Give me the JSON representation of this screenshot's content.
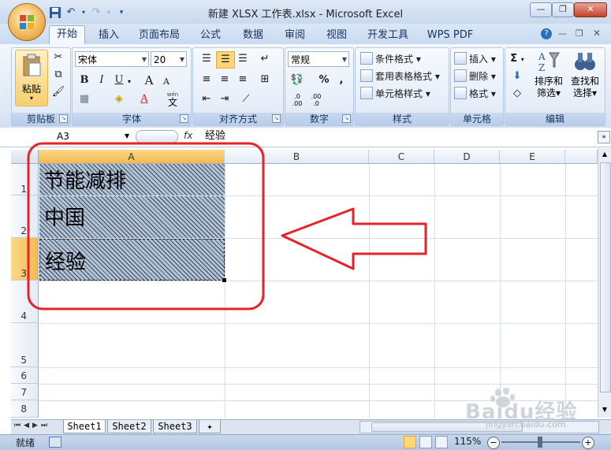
{
  "window": {
    "title": "新建 XLSX 工作表.xlsx - Microsoft Excel",
    "minimize_icon": "minimize-icon",
    "restore_icon": "restore-icon",
    "close_icon": "close-icon"
  },
  "ribbon_tabs": [
    {
      "label": "开始",
      "active": true
    },
    {
      "label": "插入"
    },
    {
      "label": "页面布局"
    },
    {
      "label": "公式"
    },
    {
      "label": "数据"
    },
    {
      "label": "审阅"
    },
    {
      "label": "视图"
    },
    {
      "label": "开发工具"
    },
    {
      "label": "WPS PDF"
    }
  ],
  "groups": {
    "clipboard": {
      "label": "剪贴板",
      "paste_label": "粘贴"
    },
    "font": {
      "label": "字体",
      "font_name": "宋体",
      "font_size": "20",
      "bold": "B",
      "italic": "I",
      "underline": "U",
      "grow": "A",
      "shrink": "A",
      "wen": "wén",
      "wen_char": "文"
    },
    "alignment": {
      "label": "对齐方式"
    },
    "number": {
      "label": "数字",
      "format": "常规",
      "percent": "%",
      "comma": ",",
      "inc_decimal": ".0\n.00",
      "dec_decimal": ".00\n.0"
    },
    "styles": {
      "label": "样式",
      "conditional": "条件格式",
      "table_format": "套用表格格式",
      "cell_styles": "单元格样式"
    },
    "cells": {
      "label": "单元格",
      "insert": "插入",
      "delete": "删除",
      "format": "格式"
    },
    "editing": {
      "label": "编辑",
      "sort_filter_1": "排序和",
      "sort_filter_2": "筛选",
      "find_select_1": "查找和",
      "find_select_2": "选择"
    }
  },
  "formula_bar": {
    "name_box": "A3",
    "fx": "fx",
    "value": "经验"
  },
  "columns": [
    "A",
    "B",
    "C",
    "D",
    "E"
  ],
  "rows": [
    "1",
    "2",
    "3",
    "4",
    "5",
    "6",
    "7",
    "8"
  ],
  "cells": {
    "A1": "节能减排",
    "A2": "中国",
    "A3": "经验"
  },
  "sheets": [
    "Sheet1",
    "Sheet2",
    "Sheet3"
  ],
  "status": {
    "ready": "就绪",
    "zoom": "115%"
  },
  "watermark": {
    "text": "Baidu经验",
    "url": "jingyan.baidu.com"
  },
  "colors": {
    "annotation_red": "#e8222a",
    "selection_header": "#f8c86a"
  }
}
